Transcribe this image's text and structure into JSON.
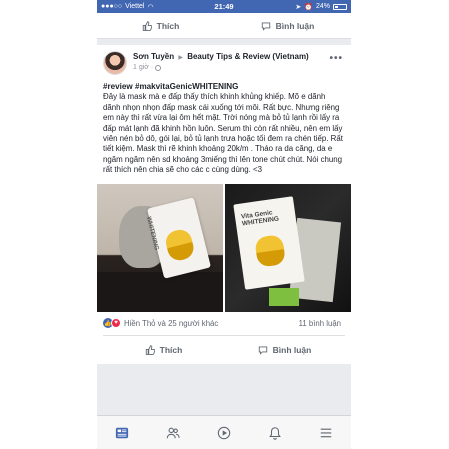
{
  "status_bar": {
    "carrier": "Viettel",
    "time": "21:49",
    "battery": "24%"
  },
  "top_actions": {
    "like": "Thích",
    "comment": "Bình luận"
  },
  "post": {
    "author": "Sơn Tuyền",
    "group": "Beauty Tips & Review (Vietnam)",
    "time": "1 giờ ·",
    "hashtags": "#review #makvitaGenicWHITENING",
    "body": "Đây là mask mà e đấp thấy thích khinh khủng khiếp. Mõ e dãnh dãnh nhọn nhọn đấp mask cái xuống tới môi. Rất bực. Nhưng riêng em này thì rất vừa lại ôm hết mặt. Trời nóng mà bỏ tủ lạnh rồi lấy ra đấp mát lạnh đã khinh hồn luôn. Serum thì còn rất nhiều, nên em lấy viên nén bỏ dô, gói lại, bỏ tủ lạnh trưa hoặc tối đem ra chén tiếp. Rất tiết kiệm. Mask thì rẽ khinh khoảng 20k/m . Tháo ra da căng, da e ngăm ngăm nên sd khoảng 3miếng thì lên tone chút chút. Nói chung rất thích nên chia sẽ cho các c cùng dùng. <3",
    "photo_brand_text": "WHITENING",
    "photo_brand_text_2": "Vita Genic\nWHITENING",
    "reactions": "Hiền Thỏ và 25 người khác",
    "comments_count": "11 bình luận",
    "like": "Thích",
    "comment": "Bình luận"
  },
  "colors": {
    "status_bar": "#4267b2",
    "like_reaction": "#4267b2",
    "love_reaction": "#f0284a"
  },
  "bottom_nav": [
    "news-feed-icon",
    "friends-icon",
    "watch-icon",
    "notifications-icon",
    "menu-icon"
  ]
}
